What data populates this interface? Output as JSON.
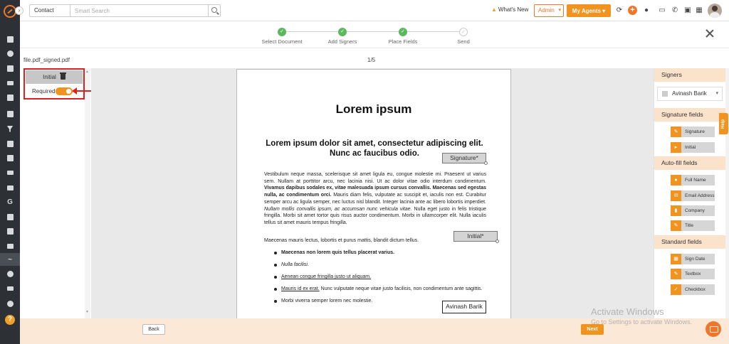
{
  "topbar": {
    "contact_select": "Contact",
    "search_placeholder": "Smart Search",
    "whats_new": "What's New",
    "admin_select": "Admin",
    "agents_button": "My Agents"
  },
  "stepper": {
    "steps": [
      {
        "label": "Select Document",
        "state": "done"
      },
      {
        "label": "Add Signers",
        "state": "done"
      },
      {
        "label": "Place Fields",
        "state": "done"
      },
      {
        "label": "Send",
        "state": "pending"
      }
    ]
  },
  "document": {
    "file_name": "file.pdf_signed.pdf",
    "page_count": "1/5",
    "title": "Lorem ipsum",
    "subtitle": "Lorem ipsum dolor sit amet, consectetur adipiscing elit. Nunc ac faucibus odio.",
    "para_1a": "Vestibulum neque massa, scelerisque sit amet ligula eu, congue molestie mi. Praesent ut varius sem. Nullam at porttitor arcu, nec lacinia nisi. Ut ac dolor vitae odio interdum condimentum. ",
    "para_1b": "Vivamus dapibus sodales ex, vitae malesuada ipsum cursus convallis. Maecenas sed egestas nulla, ac condimentum orci.",
    "para_1c": " Mauris diam felis, vulputate ac suscipit et, iaculis non est. Curabitur semper arcu ac ligula semper, nec luctus nisl blandit. Integer lacinia ante ac libero lobortis imperdiet. ",
    "para_1d": "Nullam mollis convallis ipsum, ac accumsan nunc vehicula vitae.",
    "para_1e": " Nulla eget justo in felis tristique fringilla. Morbi sit amet tortor quis risus auctor condimentum. Morbi in ullamcorper elit. Nulla iaculis tellus sit amet mauris tempus fringilla.",
    "para_2": "Maecenas mauris lectus, lobortis et purus mattis, blandit dictum tellus.",
    "list": {
      "item_1": "Maecenas non lorem quis tellus placerat varius.",
      "item_2": "Nulla facilisi.",
      "item_3": "Aenean congue fringilla justo ut aliquam.",
      "item_4a": "Mauris id ex erat.",
      "item_4b": " Nunc vulputate neque vitae justo facilisis, non condimentum ante sagittis.",
      "item_5": "Morbi viverra semper lorem nec molestie."
    },
    "placed_fields": {
      "signature": "Signature*",
      "initial": "Initial*",
      "name": "Avinash Barik"
    }
  },
  "left_panel": {
    "field_title": "Initial",
    "required_label": "Required",
    "required_on": true
  },
  "right_panel": {
    "signers_heading": "Signers",
    "signer_name": "Avinash Barik",
    "signature_heading": "Signature fields",
    "signature_fields": [
      "Signature",
      "Initial"
    ],
    "autofill_heading": "Auto-fill fields",
    "autofill_fields": [
      "Full Name",
      "Email Address",
      "Company",
      "Title"
    ],
    "standard_heading": "Standard fields",
    "standard_fields": [
      "Sign Date",
      "Textbox",
      "Checkbox"
    ],
    "help_tab": "Help"
  },
  "footer": {
    "back_label": "Back",
    "next_label": "Next"
  },
  "watermark": {
    "title": "Activate Windows",
    "subtitle": "Go to Settings to activate Windows."
  },
  "colors": {
    "accent": "#f0941f",
    "rail": "#2d3035",
    "highlight": "#e02020"
  }
}
